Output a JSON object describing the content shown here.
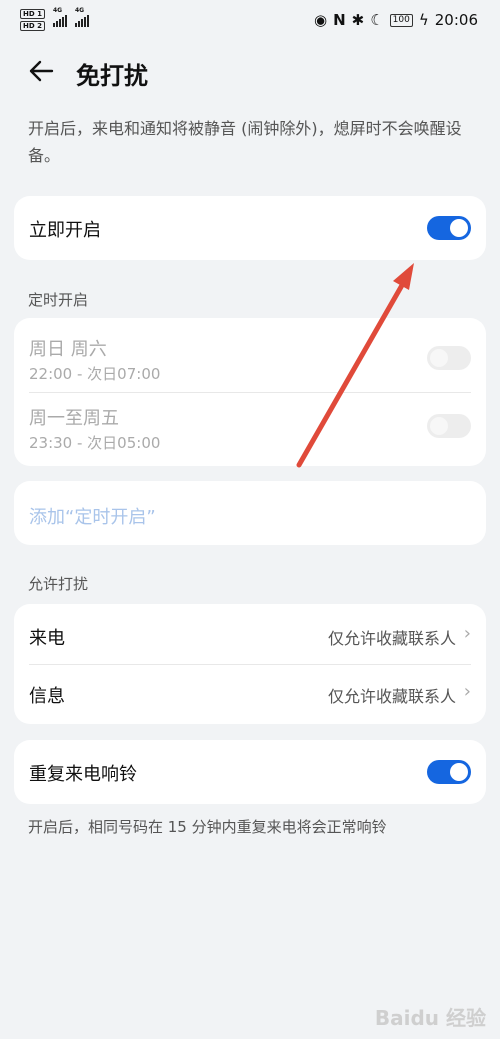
{
  "status_bar": {
    "hd1": "HD 1",
    "hd2": "HD 2",
    "network1": "4G",
    "network2": "4G",
    "battery": "100",
    "time": "20:06"
  },
  "header": {
    "title": "免打扰"
  },
  "description": "开启后，来电和通知将被静音 (闹钟除外)，熄屏时不会唤醒设备。",
  "immediate": {
    "label": "立即开启",
    "on": true
  },
  "scheduled": {
    "section_title": "定时开启",
    "items": [
      {
        "days": "周日 周六",
        "time": "22:00 - 次日07:00",
        "on": false
      },
      {
        "days": "周一至周五",
        "time": "23:30 - 次日05:00",
        "on": false
      }
    ],
    "add_label": "添加“定时开启”"
  },
  "allow": {
    "section_title": "允许打扰",
    "items": [
      {
        "label": "来电",
        "value": "仅允许收藏联系人"
      },
      {
        "label": "信息",
        "value": "仅允许收藏联系人"
      }
    ]
  },
  "repeat_call": {
    "label": "重复来电响铃",
    "on": true
  },
  "footnote": "开启后，相同号码在 15 分钟内重复来电将会正常响铃",
  "watermark": "Baidu 经验",
  "colors": {
    "accent": "#1566e0",
    "arrow": "#e04a3a",
    "background": "#f1f3f5"
  }
}
